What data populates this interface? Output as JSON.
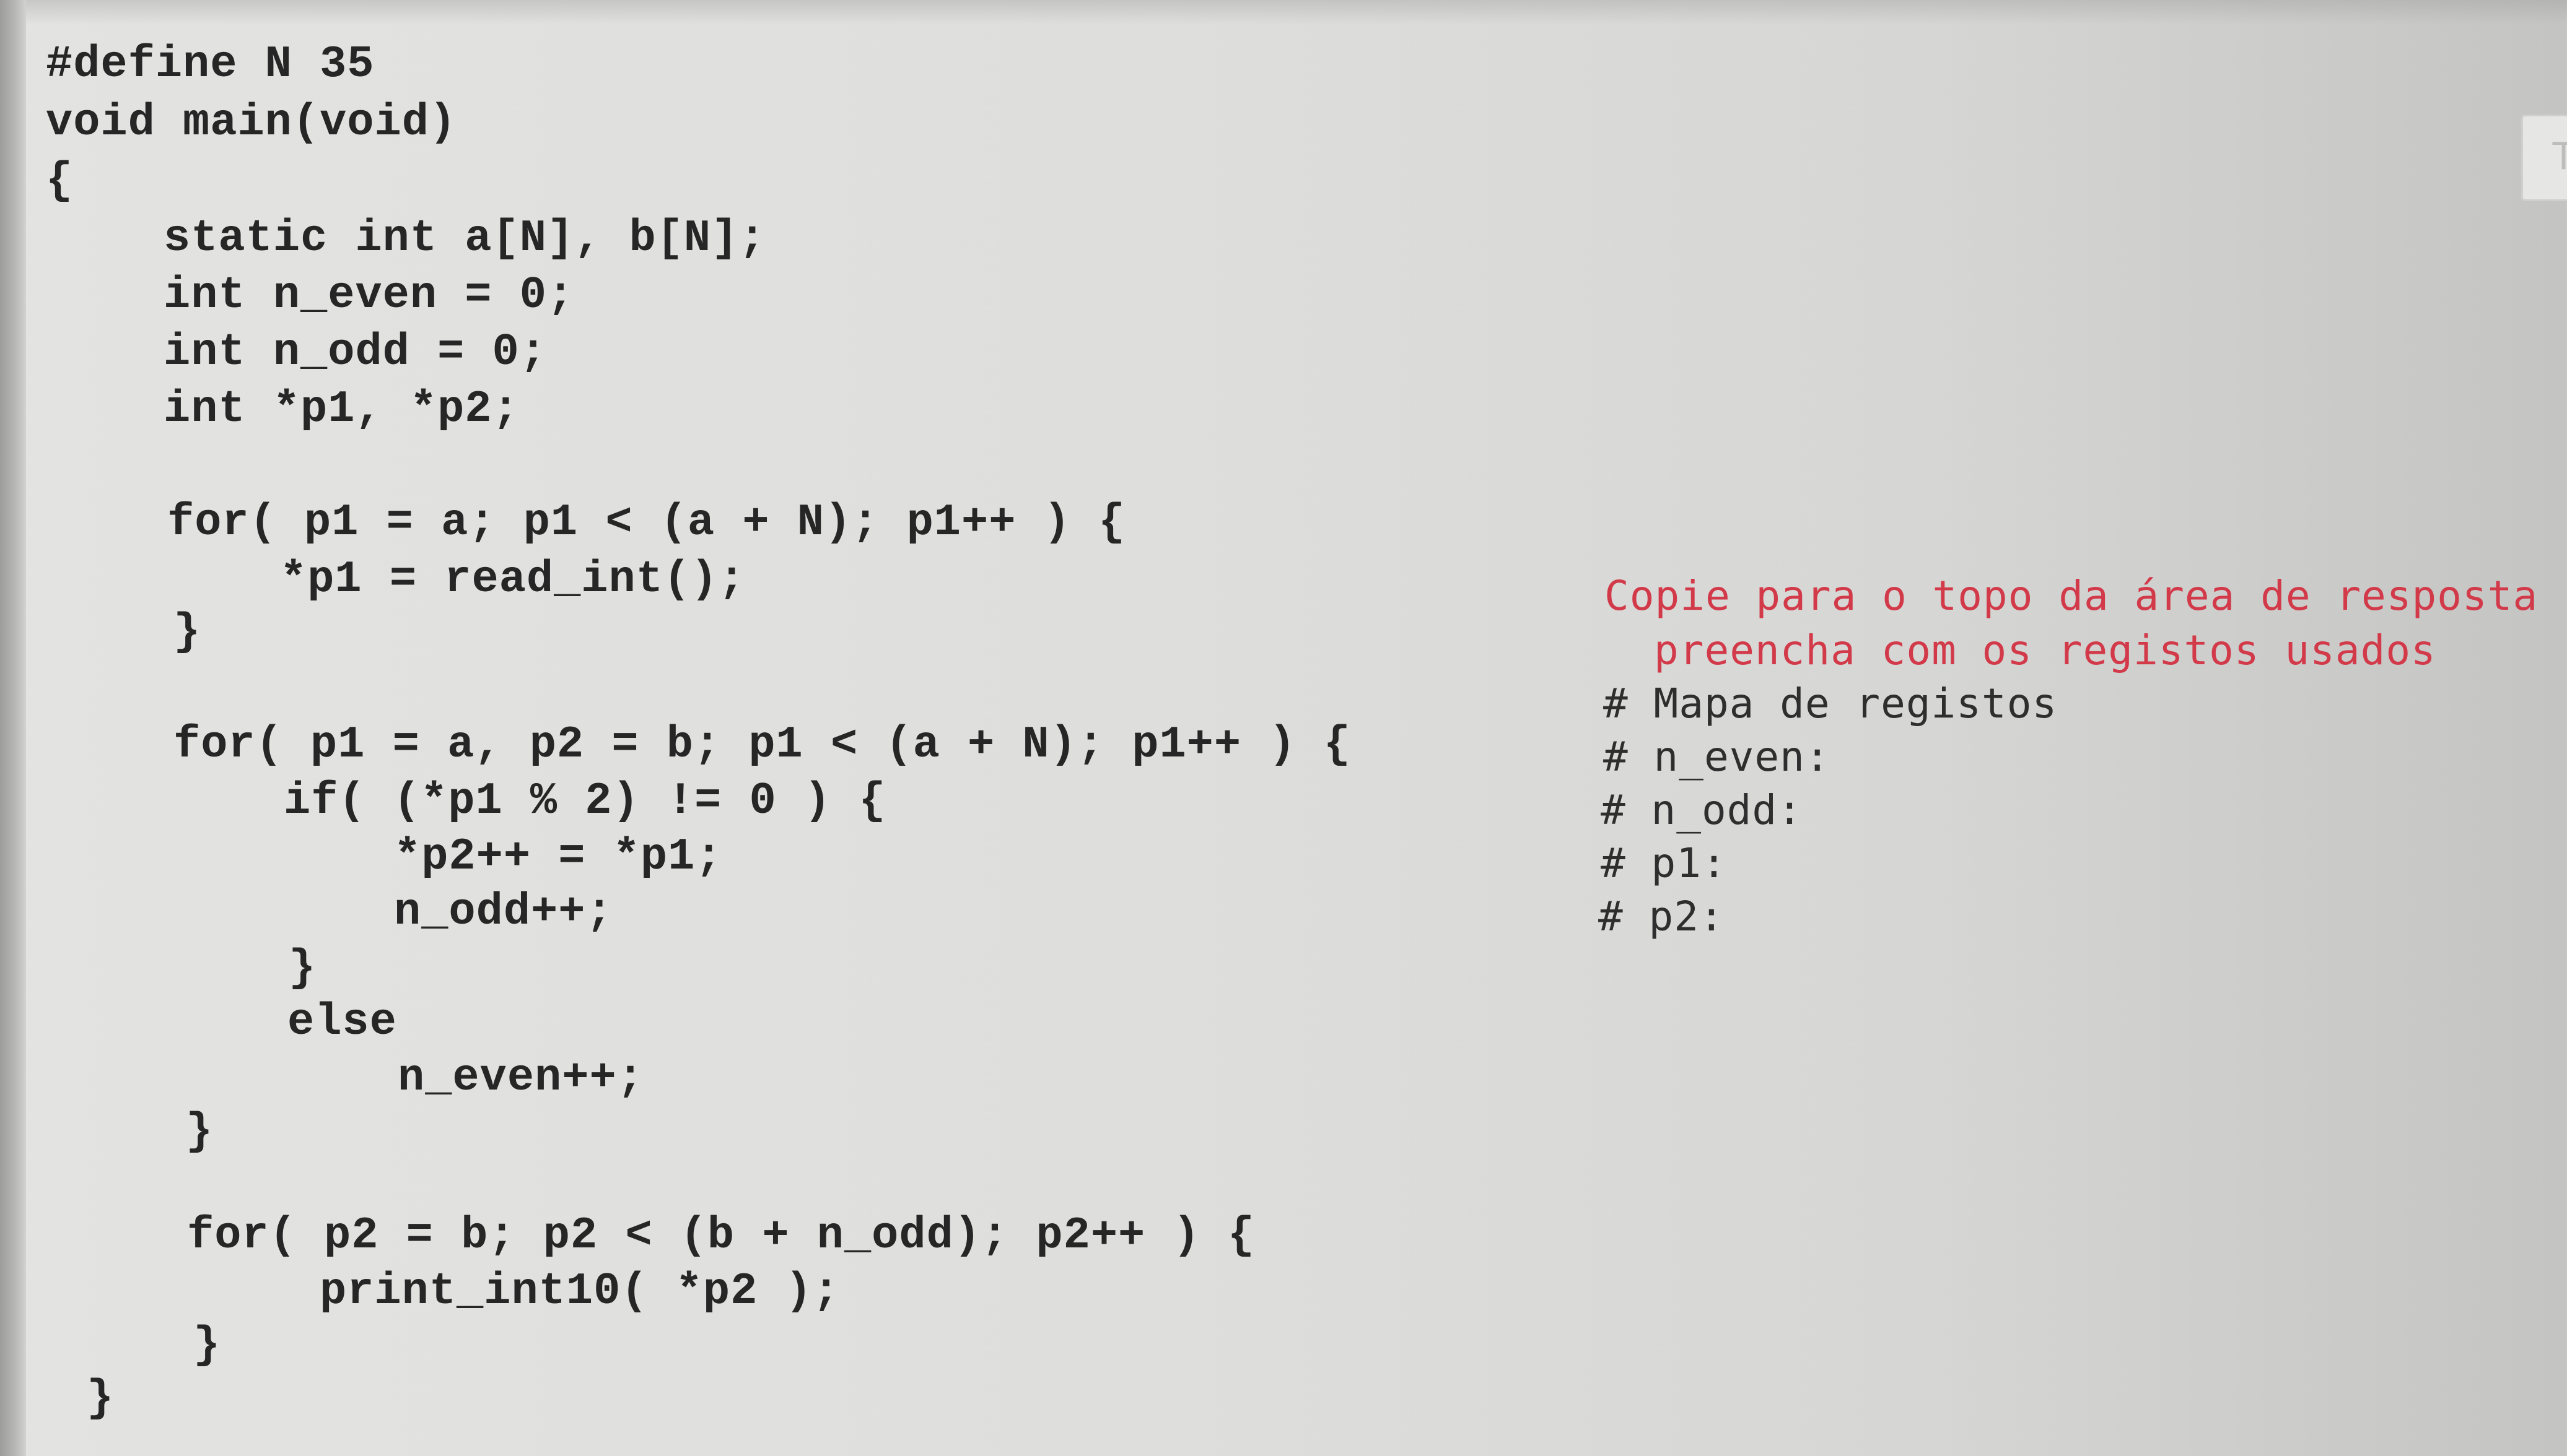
{
  "code_lines": [
    "#define N 35",
    "void main(void)",
    "{",
    "static int a[N], b[N];",
    "int n_even = 0;",
    "int n_odd = 0;",
    "int *p1, *p2;",
    "for( p1 = a; p1 < (a + N); p1++ ) {",
    "*p1 = read_int();",
    "}",
    "for( p1 = a, p2 = b; p1 < (a + N); p1++ ) {",
    "if( (*p1 % 2) != 0 ) {",
    "*p2++ = *p1;",
    "n_odd++;",
    "}",
    "else",
    "n_even++;",
    "}",
    "for( p2 = b; p2 < (b + n_odd); p2++ ) {",
    "print_int10( *p2 );",
    "}",
    "}"
  ],
  "annotation": {
    "instruction_line1": "Copie para o topo da área de resposta",
    "instruction_line2": "preencha com os registos usados",
    "comment_lines": [
      "# Mapa de registos",
      "# n_even:",
      "# n_odd:",
      "# p1:",
      "# p2:"
    ]
  },
  "edge_widget_label": "T",
  "colors": {
    "background": "#dededc",
    "code_text": "#262626",
    "instruction_text": "#d23a4a",
    "comment_text": "#2e2e2e"
  }
}
